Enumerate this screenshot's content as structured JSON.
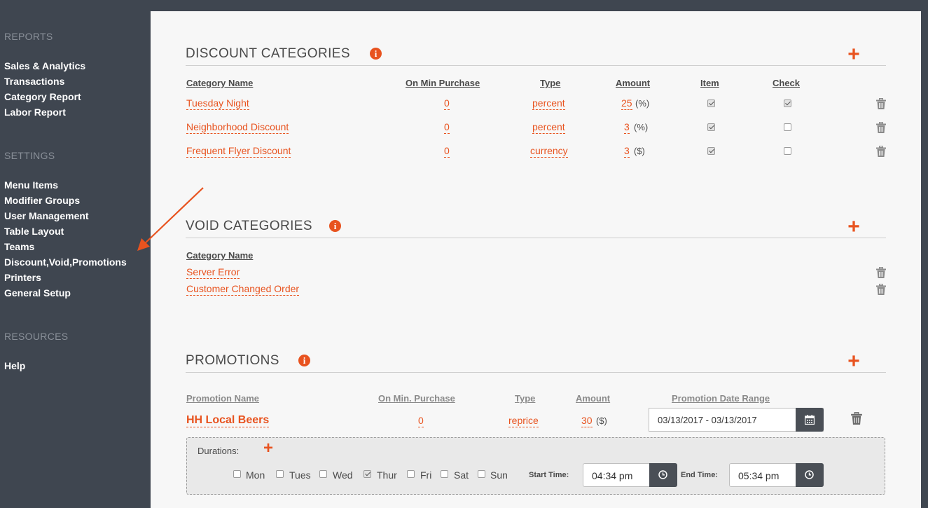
{
  "sidebar": {
    "reports_heading": "REPORTS",
    "reports": [
      "Sales & Analytics",
      "Transactions",
      "Category Report",
      "Labor Report"
    ],
    "settings_heading": "SETTINGS",
    "settings": [
      "Menu Items",
      "Modifier Groups",
      "User Management",
      "Table Layout",
      "Teams",
      "Discount,Void,Promotions",
      "Printers",
      "General Setup"
    ],
    "resources_heading": "RESOURCES",
    "resources": [
      "Help"
    ]
  },
  "discount": {
    "title": "DISCOUNT CATEGORIES",
    "headers": {
      "name": "Category Name",
      "min": "On Min Purchase",
      "type": "Type",
      "amount": "Amount",
      "item": "Item",
      "check": "Check"
    },
    "rows": [
      {
        "name": "Tuesday Night",
        "min": "0",
        "type": "percent",
        "amount": "25",
        "unit": "(%)",
        "item": true,
        "check": true
      },
      {
        "name": "Neighborhood Discount",
        "min": "0",
        "type": "percent",
        "amount": "3",
        "unit": "(%)",
        "item": true,
        "check": false
      },
      {
        "name": "Frequent Flyer Discount",
        "min": "0",
        "type": "currency",
        "amount": "3",
        "unit": "($)",
        "item": true,
        "check": false
      }
    ]
  },
  "void": {
    "title": "VOID CATEGORIES",
    "header": "Category Name",
    "rows": [
      "Server Error",
      "Customer Changed Order"
    ]
  },
  "promotions": {
    "title": "PROMOTIONS",
    "headers": {
      "name": "Promotion Name",
      "min": "On Min. Purchase",
      "type": "Type",
      "amount": "Amount",
      "range": "Promotion Date Range"
    },
    "row": {
      "name": "HH Local Beers",
      "min": "0",
      "type": "reprice",
      "amount": "30",
      "unit": "($)",
      "date_range": "03/13/2017 - 03/13/2017"
    },
    "durations_label": "Durations:",
    "days": [
      {
        "label": "Mon",
        "checked": false
      },
      {
        "label": "Tues",
        "checked": false
      },
      {
        "label": "Wed",
        "checked": false
      },
      {
        "label": "Thur",
        "checked": true
      },
      {
        "label": "Fri",
        "checked": false
      },
      {
        "label": "Sat",
        "checked": false
      },
      {
        "label": "Sun",
        "checked": false
      }
    ],
    "start_label": "Start Time:",
    "start_time": "04:34 pm",
    "end_label": "End Time:",
    "end_time": "05:34 pm"
  },
  "colors": {
    "accent": "#e8531f",
    "sidebar": "#3f4650",
    "panel": "#f7f7f7"
  }
}
